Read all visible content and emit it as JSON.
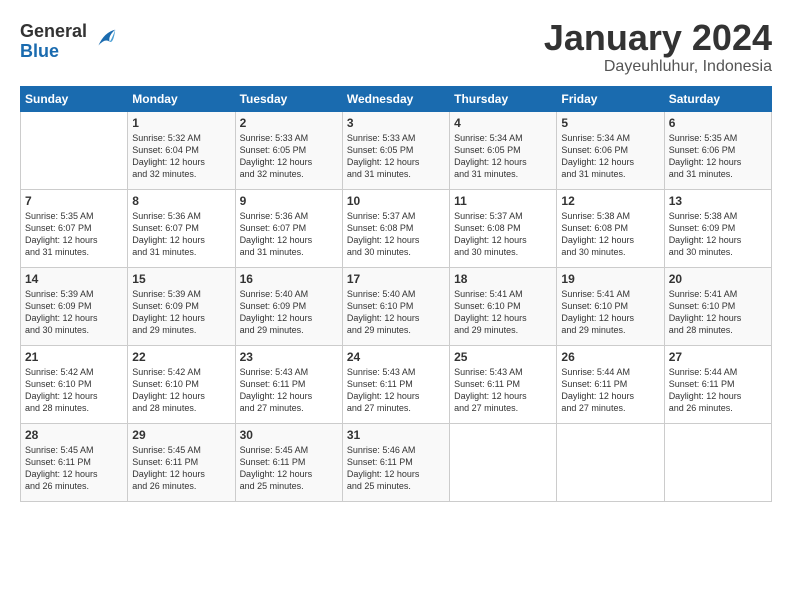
{
  "header": {
    "logo_general": "General",
    "logo_blue": "Blue",
    "month_title": "January 2024",
    "subtitle": "Dayeuhluhur, Indonesia"
  },
  "calendar": {
    "days_of_week": [
      "Sunday",
      "Monday",
      "Tuesday",
      "Wednesday",
      "Thursday",
      "Friday",
      "Saturday"
    ],
    "weeks": [
      [
        {
          "day": "",
          "text": ""
        },
        {
          "day": "1",
          "text": "Sunrise: 5:32 AM\nSunset: 6:04 PM\nDaylight: 12 hours\nand 32 minutes."
        },
        {
          "day": "2",
          "text": "Sunrise: 5:33 AM\nSunset: 6:05 PM\nDaylight: 12 hours\nand 32 minutes."
        },
        {
          "day": "3",
          "text": "Sunrise: 5:33 AM\nSunset: 6:05 PM\nDaylight: 12 hours\nand 31 minutes."
        },
        {
          "day": "4",
          "text": "Sunrise: 5:34 AM\nSunset: 6:05 PM\nDaylight: 12 hours\nand 31 minutes."
        },
        {
          "day": "5",
          "text": "Sunrise: 5:34 AM\nSunset: 6:06 PM\nDaylight: 12 hours\nand 31 minutes."
        },
        {
          "day": "6",
          "text": "Sunrise: 5:35 AM\nSunset: 6:06 PM\nDaylight: 12 hours\nand 31 minutes."
        }
      ],
      [
        {
          "day": "7",
          "text": "Sunrise: 5:35 AM\nSunset: 6:07 PM\nDaylight: 12 hours\nand 31 minutes."
        },
        {
          "day": "8",
          "text": "Sunrise: 5:36 AM\nSunset: 6:07 PM\nDaylight: 12 hours\nand 31 minutes."
        },
        {
          "day": "9",
          "text": "Sunrise: 5:36 AM\nSunset: 6:07 PM\nDaylight: 12 hours\nand 31 minutes."
        },
        {
          "day": "10",
          "text": "Sunrise: 5:37 AM\nSunset: 6:08 PM\nDaylight: 12 hours\nand 30 minutes."
        },
        {
          "day": "11",
          "text": "Sunrise: 5:37 AM\nSunset: 6:08 PM\nDaylight: 12 hours\nand 30 minutes."
        },
        {
          "day": "12",
          "text": "Sunrise: 5:38 AM\nSunset: 6:08 PM\nDaylight: 12 hours\nand 30 minutes."
        },
        {
          "day": "13",
          "text": "Sunrise: 5:38 AM\nSunset: 6:09 PM\nDaylight: 12 hours\nand 30 minutes."
        }
      ],
      [
        {
          "day": "14",
          "text": "Sunrise: 5:39 AM\nSunset: 6:09 PM\nDaylight: 12 hours\nand 30 minutes."
        },
        {
          "day": "15",
          "text": "Sunrise: 5:39 AM\nSunset: 6:09 PM\nDaylight: 12 hours\nand 29 minutes."
        },
        {
          "day": "16",
          "text": "Sunrise: 5:40 AM\nSunset: 6:09 PM\nDaylight: 12 hours\nand 29 minutes."
        },
        {
          "day": "17",
          "text": "Sunrise: 5:40 AM\nSunset: 6:10 PM\nDaylight: 12 hours\nand 29 minutes."
        },
        {
          "day": "18",
          "text": "Sunrise: 5:41 AM\nSunset: 6:10 PM\nDaylight: 12 hours\nand 29 minutes."
        },
        {
          "day": "19",
          "text": "Sunrise: 5:41 AM\nSunset: 6:10 PM\nDaylight: 12 hours\nand 29 minutes."
        },
        {
          "day": "20",
          "text": "Sunrise: 5:41 AM\nSunset: 6:10 PM\nDaylight: 12 hours\nand 28 minutes."
        }
      ],
      [
        {
          "day": "21",
          "text": "Sunrise: 5:42 AM\nSunset: 6:10 PM\nDaylight: 12 hours\nand 28 minutes."
        },
        {
          "day": "22",
          "text": "Sunrise: 5:42 AM\nSunset: 6:10 PM\nDaylight: 12 hours\nand 28 minutes."
        },
        {
          "day": "23",
          "text": "Sunrise: 5:43 AM\nSunset: 6:11 PM\nDaylight: 12 hours\nand 27 minutes."
        },
        {
          "day": "24",
          "text": "Sunrise: 5:43 AM\nSunset: 6:11 PM\nDaylight: 12 hours\nand 27 minutes."
        },
        {
          "day": "25",
          "text": "Sunrise: 5:43 AM\nSunset: 6:11 PM\nDaylight: 12 hours\nand 27 minutes."
        },
        {
          "day": "26",
          "text": "Sunrise: 5:44 AM\nSunset: 6:11 PM\nDaylight: 12 hours\nand 27 minutes."
        },
        {
          "day": "27",
          "text": "Sunrise: 5:44 AM\nSunset: 6:11 PM\nDaylight: 12 hours\nand 26 minutes."
        }
      ],
      [
        {
          "day": "28",
          "text": "Sunrise: 5:45 AM\nSunset: 6:11 PM\nDaylight: 12 hours\nand 26 minutes."
        },
        {
          "day": "29",
          "text": "Sunrise: 5:45 AM\nSunset: 6:11 PM\nDaylight: 12 hours\nand 26 minutes."
        },
        {
          "day": "30",
          "text": "Sunrise: 5:45 AM\nSunset: 6:11 PM\nDaylight: 12 hours\nand 25 minutes."
        },
        {
          "day": "31",
          "text": "Sunrise: 5:46 AM\nSunset: 6:11 PM\nDaylight: 12 hours\nand 25 minutes."
        },
        {
          "day": "",
          "text": ""
        },
        {
          "day": "",
          "text": ""
        },
        {
          "day": "",
          "text": ""
        }
      ]
    ]
  }
}
